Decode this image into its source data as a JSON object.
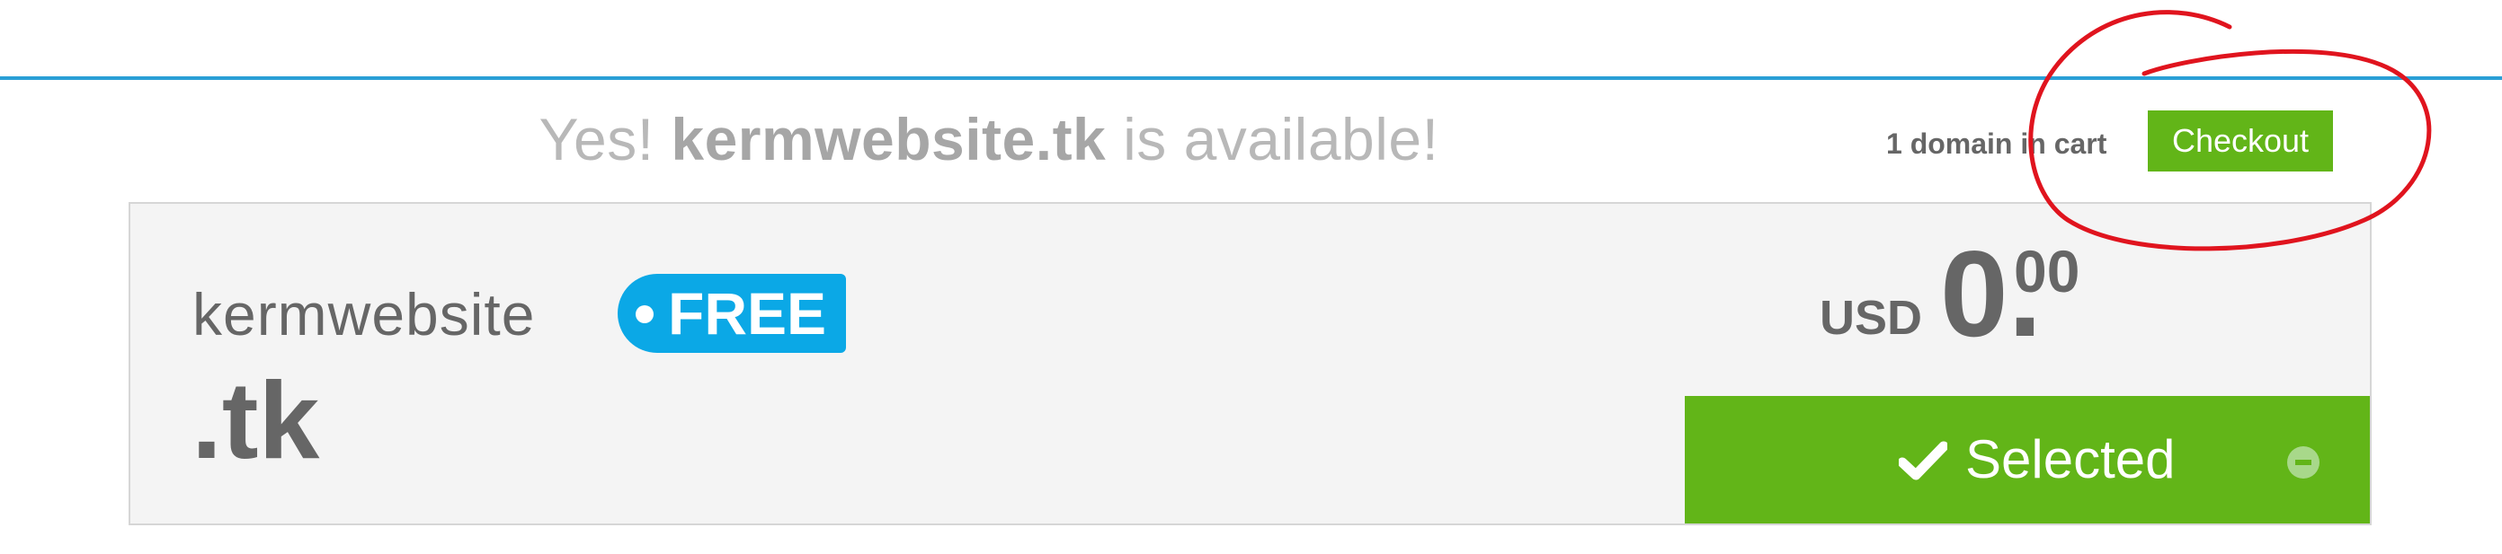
{
  "availability": {
    "prefix": "Yes! ",
    "domain": "kermwebsite.tk",
    "suffix": " is available!"
  },
  "cart": {
    "count_text": "1 domain in cart",
    "checkout_label": "Checkout"
  },
  "result": {
    "sld": "kermwebsite",
    "badge": "FREE",
    "tld": ".tk",
    "currency": "USD",
    "price_whole": "0.",
    "price_cents": "00",
    "selected_label": "Selected"
  },
  "colors": {
    "accent_blue": "#2a9fd6",
    "badge_blue": "#0ba8e6",
    "green": "#62b518",
    "annotation_red": "#e0141e"
  },
  "icons": {
    "selected": "check-icon",
    "remove": "minus-circle-icon",
    "badge": "dot-icon"
  }
}
